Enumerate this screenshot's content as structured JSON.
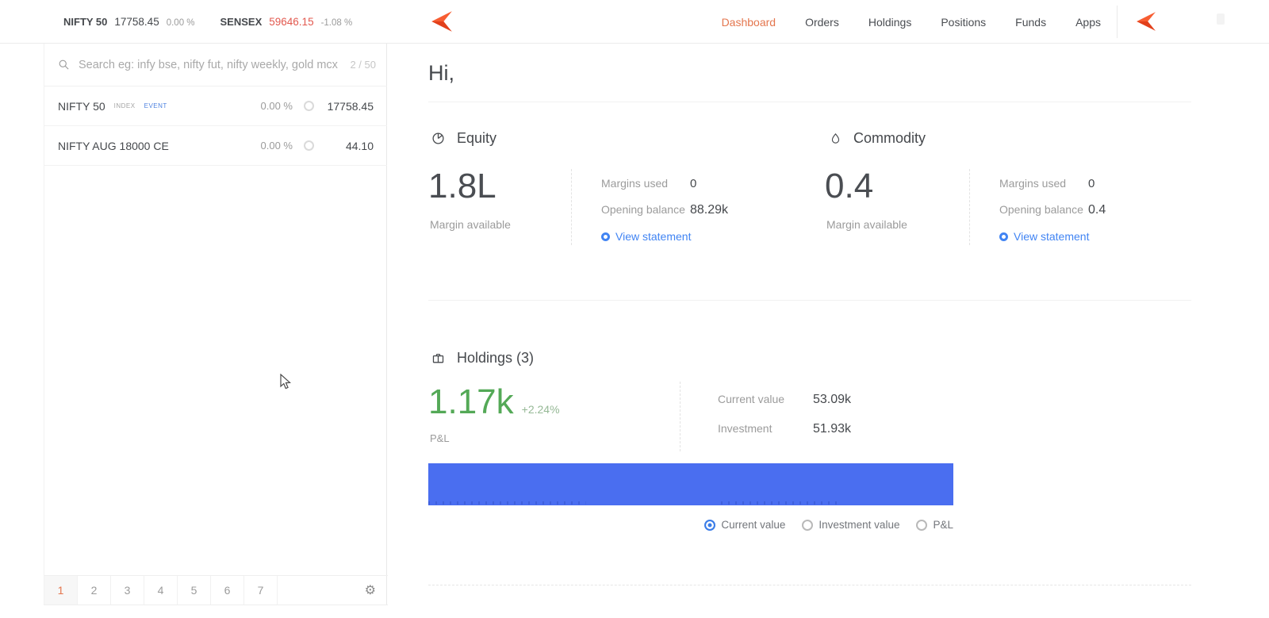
{
  "topbar": {
    "indices": [
      {
        "name": "NIFTY 50",
        "value": "17758.45",
        "change": "0.00 %"
      },
      {
        "name": "SENSEX",
        "value": "59646.15",
        "change": "-1.08 %"
      }
    ],
    "nav": [
      {
        "label": "Dashboard"
      },
      {
        "label": "Orders"
      },
      {
        "label": "Holdings"
      },
      {
        "label": "Positions"
      },
      {
        "label": "Funds"
      },
      {
        "label": "Apps"
      }
    ],
    "active_nav": "Dashboard"
  },
  "sidebar": {
    "search": {
      "placeholder": "Search eg: infy bse, nifty fut, nifty weekly, gold mcx",
      "counter": "2 / 50"
    },
    "watchlist": [
      {
        "name": "NIFTY 50",
        "tag_index": "INDEX",
        "tag_event": "EVENT",
        "change": "0.00 %",
        "price": "17758.45"
      },
      {
        "name": "NIFTY AUG 18000 CE",
        "change": "0.00 %",
        "price": "44.10"
      }
    ],
    "pagination": {
      "pages": [
        "1",
        "2",
        "3",
        "4",
        "5",
        "6",
        "7"
      ],
      "active_page": "1"
    }
  },
  "main": {
    "greeting": "Hi,",
    "equity": {
      "title": "Equity",
      "amount": "1.8L",
      "amount_label": "Margin available",
      "margins_used_label": "Margins used",
      "margins_used": "0",
      "opening_balance_label": "Opening balance",
      "opening_balance": "88.29k",
      "link": "View statement"
    },
    "commodity": {
      "title": "Commodity",
      "amount": "0.4",
      "amount_label": "Margin available",
      "margins_used_label": "Margins used",
      "margins_used": "0",
      "opening_balance_label": "Opening balance",
      "opening_balance": "0.4",
      "link": "View statement"
    },
    "holdings": {
      "title": "Holdings (3)",
      "pnl": "1.17k",
      "pnl_pct": "+2.24%",
      "pnl_label": "P&L",
      "current_value_label": "Current value",
      "current_value": "53.09k",
      "investment_label": "Investment",
      "investment": "51.93k"
    },
    "chart_controls": [
      {
        "label": "Current value"
      },
      {
        "label": "Investment value"
      },
      {
        "label": "P&L"
      }
    ],
    "selected_control": "Current value"
  },
  "icons": {
    "settings": "⚙"
  },
  "colors": {
    "accent_orange": "#e4764e",
    "link_blue": "#4184f3",
    "bar_blue": "#4a6ef0",
    "pnl_green": "#54a957",
    "negative_red": "#e2584e"
  },
  "chart_data": {
    "type": "bar",
    "orientation": "horizontal",
    "categories": [
      "Current value"
    ],
    "values": [
      53.09
    ],
    "unit": "k",
    "bar_color": "#4a6ef0",
    "legend_position": "bottom-right",
    "note": "Single solid bar filling full chart width; selected metric 'Current value' = 53.09k for 3 holdings"
  }
}
